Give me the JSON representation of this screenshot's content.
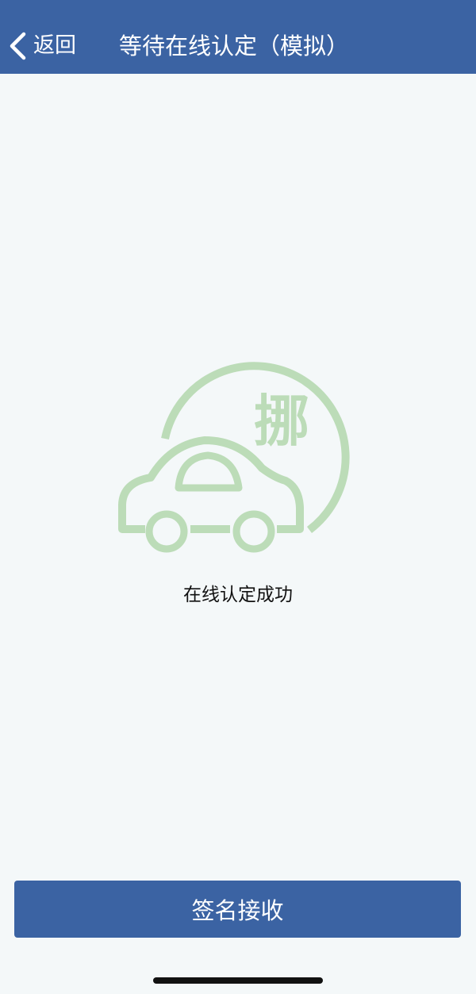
{
  "nav": {
    "back_label": "返回",
    "title": "等待在线认定（模拟）"
  },
  "illustration": {
    "badge_char": "挪",
    "color": "#bcdcb8"
  },
  "status": {
    "message": "在线认定成功"
  },
  "actions": {
    "sign_label": "签名接收"
  },
  "colors": {
    "primary": "#3b63a3",
    "background": "#f4f8f9"
  }
}
